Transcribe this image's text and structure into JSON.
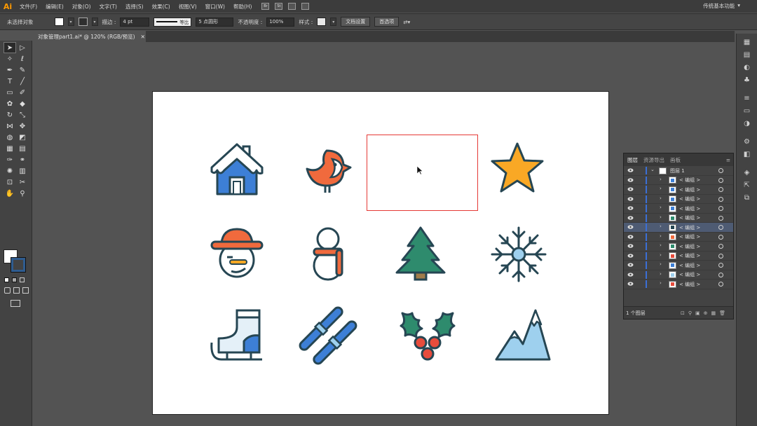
{
  "menu": {
    "logo": "Ai",
    "items": [
      "文件(F)",
      "编辑(E)",
      "对象(O)",
      "文字(T)",
      "选择(S)",
      "效果(C)",
      "视图(V)",
      "窗口(W)",
      "帮助(H)"
    ],
    "bridge_icon": "Br",
    "stock_icon": "St",
    "workspace_label": "传统基本功能",
    "workspace_arrow": "▾"
  },
  "control": {
    "no_selection": "未选择对象",
    "stroke_label": "描边 :",
    "stroke_value": "4 pt",
    "profile_label": "等比",
    "brush_label": "5 点圆形",
    "opacity_label": "不透明度 :",
    "opacity_value": "100%",
    "style_label": "样式 :",
    "doc_setup_button": "文档设置",
    "preferences_button": "首选项"
  },
  "document": {
    "tab_title": "对象管理part1.ai* @ 120% (RGB/预览)",
    "close_glyph": "✕"
  },
  "layers_panel": {
    "tabs": [
      "图层",
      "资源导出",
      "画板"
    ],
    "layer_name": "图层 1",
    "rows": [
      "< 编组 >",
      "< 编组 >",
      "< 编组 >",
      "< 编组 >",
      "< 编组 >",
      "< 编组 >",
      "< 编组 >",
      "< 编组 >",
      "< 编组 >",
      "< 编组 >",
      "< 编组 >",
      "< 编组 >"
    ],
    "selected_row": 5,
    "footer": "1 个图层"
  },
  "colors": {
    "navy": "#264653",
    "blue": "#3d7fd6",
    "orange": "#f06a3d",
    "gold": "#f9a825",
    "green": "#2e8b6d",
    "lightblue": "#9ed0ee",
    "red": "#e74c3c",
    "selection": "#e53935"
  }
}
